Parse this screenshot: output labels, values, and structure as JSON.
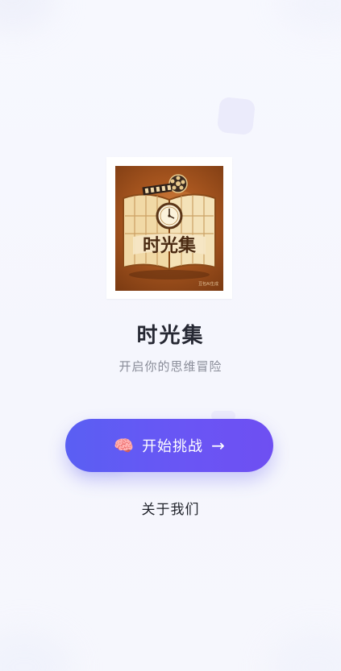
{
  "app": {
    "title": "时光集",
    "subtitle": "开启你的思维冒险",
    "logo_text": "时光集",
    "logo_watermark": "豆包AI生成"
  },
  "actions": {
    "start_icon": "brain-emoji",
    "start_emoji": "🧠",
    "start_label": "开始挑战",
    "start_arrow": "→",
    "about_label": "关于我们"
  },
  "colors": {
    "background": "#f6f7fd",
    "button_gradient_start": "#5a5ff3",
    "button_gradient_end": "#6e4ff2",
    "title": "#262833",
    "subtitle": "#8a8d99"
  }
}
